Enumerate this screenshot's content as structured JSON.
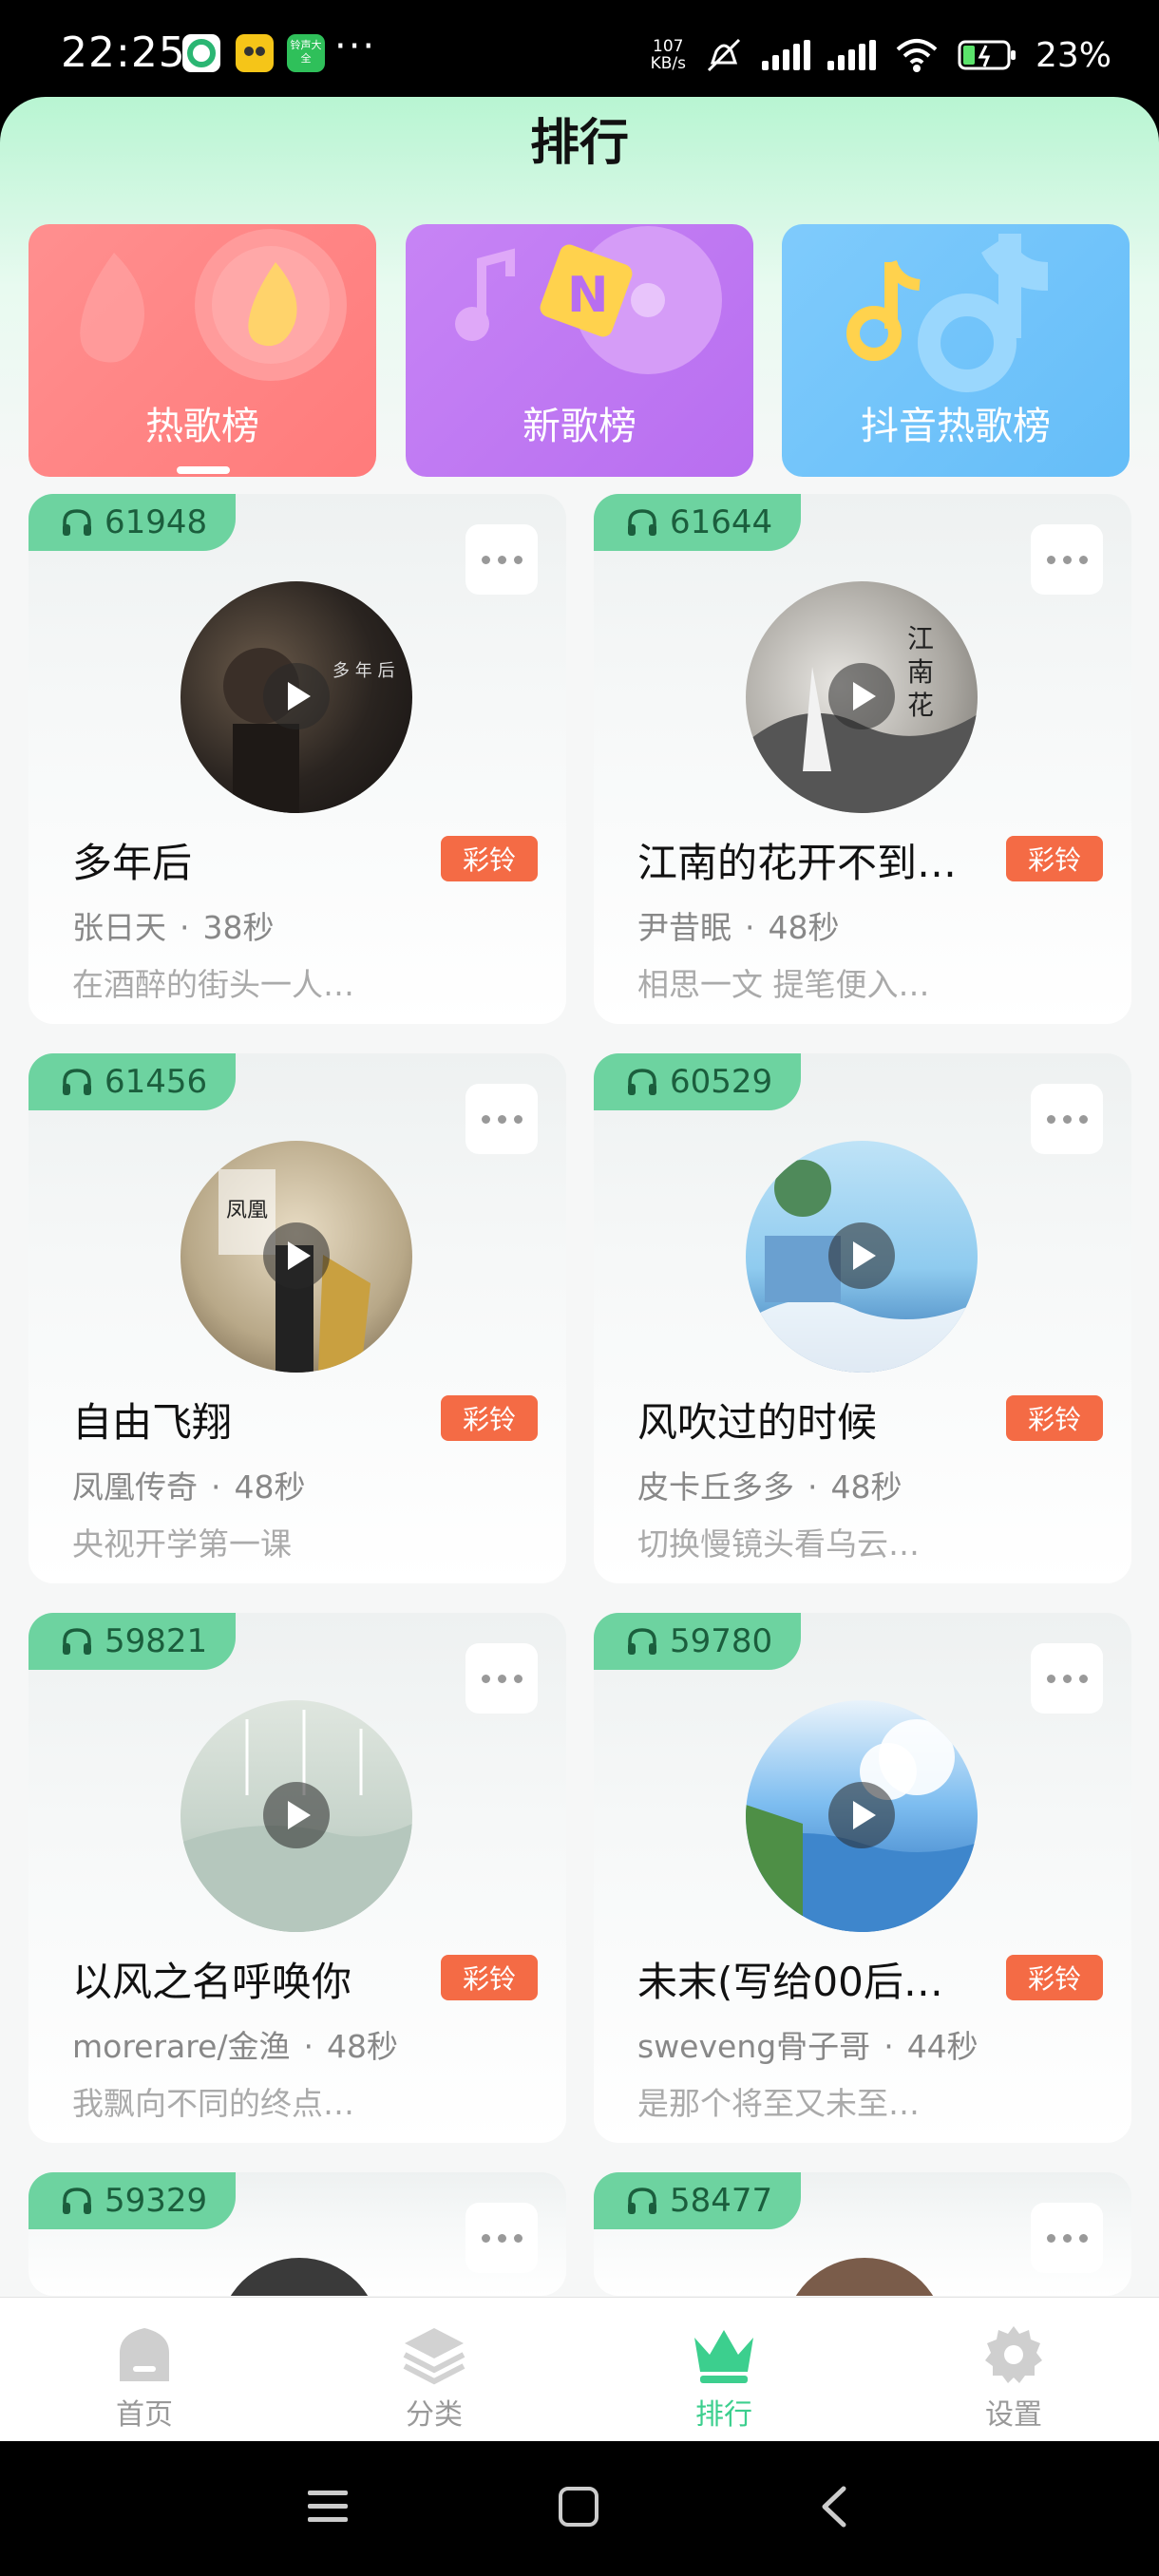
{
  "status_bar": {
    "time": "22:25",
    "app_icon_badge": "铃声大全",
    "dots": "···",
    "net_speed_value": "107",
    "net_speed_unit": "KB/s",
    "battery": "23%"
  },
  "page": {
    "title": "排行"
  },
  "categories": [
    {
      "label": "热歌榜",
      "color": "#ff8c8c",
      "active": true
    },
    {
      "label": "新歌榜",
      "color": "#c77df2",
      "active": false
    },
    {
      "label": "抖音热歌榜",
      "color": "#6fc3fb",
      "active": false
    }
  ],
  "songs": [
    {
      "plays": "61948",
      "title": "多年后",
      "artist": "张日天",
      "duration": "38秒",
      "desc": "在酒醉的街头一人…",
      "tag": "彩铃"
    },
    {
      "plays": "61644",
      "title": "江南的花开不到…",
      "artist": "尹昔眠",
      "duration": "48秒",
      "desc": "相思一文 提笔便入…",
      "tag": "彩铃"
    },
    {
      "plays": "61456",
      "title": "自由飞翔",
      "artist": "凤凰传奇",
      "duration": "48秒",
      "desc": "央视开学第一课",
      "tag": "彩铃"
    },
    {
      "plays": "60529",
      "title": "风吹过的时候",
      "artist": "皮卡丘多多",
      "duration": "48秒",
      "desc": "切换慢镜头看乌云…",
      "tag": "彩铃"
    },
    {
      "plays": "59821",
      "title": "以风之名呼唤你",
      "artist": "morerare/金渔",
      "duration": "48秒",
      "desc": "我飘向不同的终点…",
      "tag": "彩铃"
    },
    {
      "plays": "59780",
      "title": "未末(写给00后…",
      "artist": "sweveng骨子哥",
      "duration": "44秒",
      "desc": "是那个将至又未至…",
      "tag": "彩铃"
    },
    {
      "plays": "59329"
    },
    {
      "plays": "58477"
    }
  ],
  "meta_separator": "·",
  "bottom_nav": [
    {
      "label": "首页",
      "icon": "home-icon"
    },
    {
      "label": "分类",
      "icon": "layers-icon"
    },
    {
      "label": "排行",
      "icon": "crown-icon",
      "active": true
    },
    {
      "label": "设置",
      "icon": "gear-icon"
    }
  ],
  "colors": {
    "accent": "#3ccf8e",
    "badge": "#6dd3a0",
    "ring_tag": "#f46b45"
  }
}
